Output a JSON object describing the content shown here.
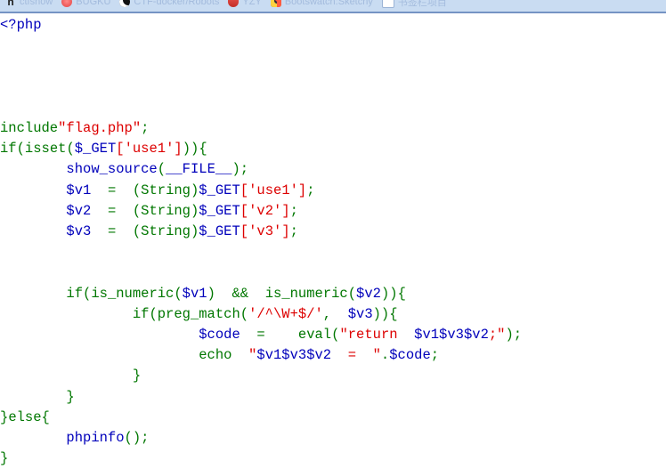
{
  "browser": {
    "bookmark_bar": {
      "items": [
        {
          "label": "ctfshow",
          "icon": "ctfshow-favicon"
        },
        {
          "label": "BUGKU",
          "icon": "bugku-favicon"
        },
        {
          "label": "CTF-docker/Robots",
          "icon": "docker-favicon"
        },
        {
          "label": "YZY",
          "icon": "yzy-favicon"
        },
        {
          "label": "Bootswatch:Sketchy",
          "icon": "bootswatch-favicon"
        },
        {
          "label": "书签栏项目",
          "icon": "generic-page-favicon"
        }
      ]
    }
  },
  "colors": {
    "background": "#ffffff",
    "bookmark_bar_bg": "#c9dcf2",
    "bookmark_bar_border": "#7593c4",
    "keyword": "#007700",
    "string": "#dd0000",
    "variable": "#0000bb",
    "default": "#000000"
  },
  "source": {
    "language": "php",
    "file_displayed": "flag.php",
    "lines": [
      [
        {
          "t": "<?php",
          "c": "var"
        }
      ],
      [
        {
          "t": "",
          "c": "default"
        }
      ],
      [
        {
          "t": "",
          "c": "default"
        }
      ],
      [
        {
          "t": "include",
          "c": "kw"
        },
        {
          "t": "\"flag.php\"",
          "c": "str"
        },
        {
          "t": ";",
          "c": "kw"
        }
      ],
      [
        {
          "t": "if",
          "c": "kw"
        },
        {
          "t": "(",
          "c": "kw"
        },
        {
          "t": "isset",
          "c": "kw"
        },
        {
          "t": "(",
          "c": "kw"
        },
        {
          "t": "$_GET",
          "c": "var"
        },
        {
          "t": "[",
          "c": "str"
        },
        {
          "t": "'use1'",
          "c": "str"
        },
        {
          "t": "]",
          "c": "str"
        },
        {
          "t": "))",
          "c": "kw"
        },
        {
          "t": "{",
          "c": "kw"
        }
      ],
      [
        {
          "t": "        ",
          "c": "default"
        },
        {
          "t": "show_source",
          "c": "var"
        },
        {
          "t": "(",
          "c": "kw"
        },
        {
          "t": "__FILE__",
          "c": "var"
        },
        {
          "t": ")",
          "c": "kw"
        },
        {
          "t": ";",
          "c": "kw"
        }
      ],
      [
        {
          "t": "        ",
          "c": "default"
        },
        {
          "t": "$v1",
          "c": "var"
        },
        {
          "t": "  ",
          "c": "default"
        },
        {
          "t": "=",
          "c": "kw"
        },
        {
          "t": "  ",
          "c": "default"
        },
        {
          "t": "(String)",
          "c": "kw"
        },
        {
          "t": "$_GET",
          "c": "var"
        },
        {
          "t": "[",
          "c": "str"
        },
        {
          "t": "'use1'",
          "c": "str"
        },
        {
          "t": "]",
          "c": "str"
        },
        {
          "t": ";",
          "c": "kw"
        }
      ],
      [
        {
          "t": "        ",
          "c": "default"
        },
        {
          "t": "$v2",
          "c": "var"
        },
        {
          "t": "  ",
          "c": "default"
        },
        {
          "t": "=",
          "c": "kw"
        },
        {
          "t": "  ",
          "c": "default"
        },
        {
          "t": "(String)",
          "c": "kw"
        },
        {
          "t": "$_GET",
          "c": "var"
        },
        {
          "t": "[",
          "c": "str"
        },
        {
          "t": "'v2'",
          "c": "str"
        },
        {
          "t": "]",
          "c": "str"
        },
        {
          "t": ";",
          "c": "kw"
        }
      ],
      [
        {
          "t": "        ",
          "c": "default"
        },
        {
          "t": "$v3",
          "c": "var"
        },
        {
          "t": "  ",
          "c": "default"
        },
        {
          "t": "=",
          "c": "kw"
        },
        {
          "t": "  ",
          "c": "default"
        },
        {
          "t": "(String)",
          "c": "kw"
        },
        {
          "t": "$_GET",
          "c": "var"
        },
        {
          "t": "[",
          "c": "str"
        },
        {
          "t": "'v3'",
          "c": "str"
        },
        {
          "t": "]",
          "c": "str"
        },
        {
          "t": ";",
          "c": "kw"
        }
      ],
      [
        {
          "t": "",
          "c": "default"
        }
      ],
      [
        {
          "t": "        ",
          "c": "default"
        },
        {
          "t": "if",
          "c": "kw"
        },
        {
          "t": "(",
          "c": "kw"
        },
        {
          "t": "is_numeric",
          "c": "kw"
        },
        {
          "t": "(",
          "c": "kw"
        },
        {
          "t": "$v1",
          "c": "var"
        },
        {
          "t": ")",
          "c": "kw"
        },
        {
          "t": "  ",
          "c": "default"
        },
        {
          "t": "&&",
          "c": "kw"
        },
        {
          "t": "  ",
          "c": "default"
        },
        {
          "t": "is_numeric",
          "c": "kw"
        },
        {
          "t": "(",
          "c": "kw"
        },
        {
          "t": "$v2",
          "c": "var"
        },
        {
          "t": "))",
          "c": "kw"
        },
        {
          "t": "{",
          "c": "kw"
        }
      ],
      [
        {
          "t": "                ",
          "c": "default"
        },
        {
          "t": "if",
          "c": "kw"
        },
        {
          "t": "(",
          "c": "kw"
        },
        {
          "t": "preg_match",
          "c": "kw"
        },
        {
          "t": "(",
          "c": "kw"
        },
        {
          "t": "'/^\\W+$/'",
          "c": "str"
        },
        {
          "t": ",",
          "c": "kw"
        },
        {
          "t": "  ",
          "c": "default"
        },
        {
          "t": "$v3",
          "c": "var"
        },
        {
          "t": "))",
          "c": "kw"
        },
        {
          "t": "{",
          "c": "kw"
        }
      ],
      [
        {
          "t": "                        ",
          "c": "default"
        },
        {
          "t": "$code",
          "c": "var"
        },
        {
          "t": "  ",
          "c": "default"
        },
        {
          "t": "=",
          "c": "kw"
        },
        {
          "t": "    ",
          "c": "default"
        },
        {
          "t": "eval",
          "c": "kw"
        },
        {
          "t": "(",
          "c": "kw"
        },
        {
          "t": "\"return  ",
          "c": "str"
        },
        {
          "t": "$v1$v3$v2",
          "c": "var"
        },
        {
          "t": ";\"",
          "c": "str"
        },
        {
          "t": ")",
          "c": "kw"
        },
        {
          "t": ";",
          "c": "kw"
        }
      ],
      [
        {
          "t": "                        ",
          "c": "default"
        },
        {
          "t": "echo",
          "c": "kw"
        },
        {
          "t": "  ",
          "c": "default"
        },
        {
          "t": "\"",
          "c": "str"
        },
        {
          "t": "$v1$v3$v2",
          "c": "var"
        },
        {
          "t": "  =  \"",
          "c": "str"
        },
        {
          "t": ".",
          "c": "kw"
        },
        {
          "t": "$code",
          "c": "var"
        },
        {
          "t": ";",
          "c": "kw"
        }
      ],
      [
        {
          "t": "                ",
          "c": "default"
        },
        {
          "t": "}",
          "c": "kw"
        }
      ],
      [
        {
          "t": "        ",
          "c": "default"
        },
        {
          "t": "}",
          "c": "kw"
        }
      ],
      [
        {
          "t": "}",
          "c": "kw"
        },
        {
          "t": "else",
          "c": "kw"
        },
        {
          "t": "{",
          "c": "kw"
        }
      ],
      [
        {
          "t": "        ",
          "c": "default"
        },
        {
          "t": "phpinfo",
          "c": "var"
        },
        {
          "t": "(",
          "c": "kw"
        },
        {
          "t": ")",
          "c": "kw"
        },
        {
          "t": ";",
          "c": "kw"
        }
      ],
      [
        {
          "t": "}",
          "c": "kw"
        }
      ]
    ]
  }
}
